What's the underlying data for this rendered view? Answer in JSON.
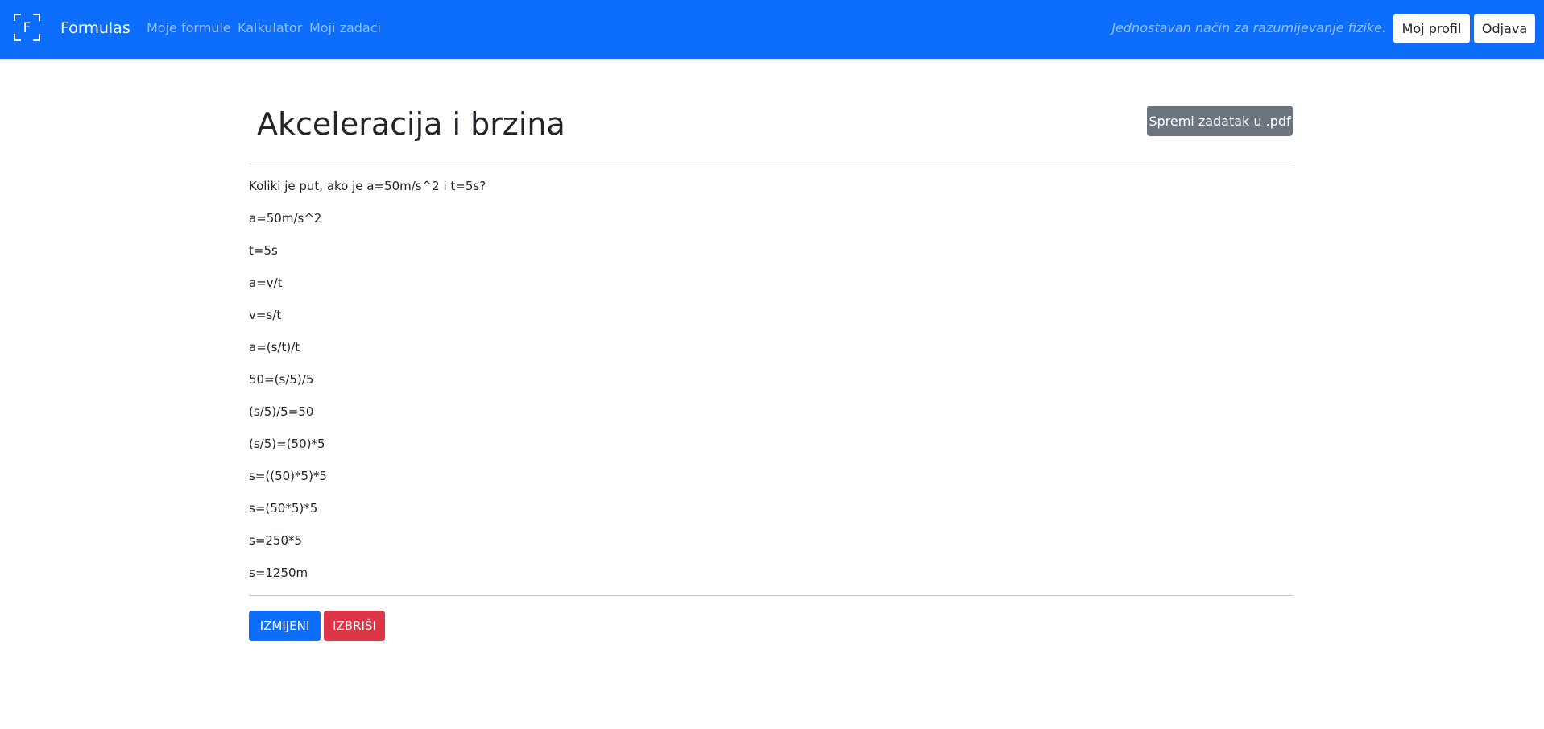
{
  "navbar": {
    "brand_letter": "F",
    "brand_name": "Formulas",
    "links": [
      "Moje formule",
      "Kalkulator",
      "Moji zadaci"
    ],
    "tagline": "Jednostavan način za razumijevanje fizike.",
    "profile_label": "Moj profil",
    "logout_label": "Odjava",
    "colors": {
      "background": "#0d6efd"
    }
  },
  "task": {
    "title": "Akceleracija i brzina",
    "pdf_button_label": "Spremi zadatak u .pdf",
    "steps": [
      "Koliki je put, ako je a=50m/s^2 i t=5s?",
      "a=50m/s^2",
      "t=5s",
      "a=v/t",
      "v=s/t",
      "a=(s/t)/t",
      "50=(s/5)/5",
      "(s/5)/5=50",
      "(s/5)=(50)*5",
      "s=((50)*5)*5",
      "s=(50*5)*5",
      "s=250*5",
      "s=1250m"
    ]
  },
  "actions": {
    "edit_label": "IZMIJENI",
    "delete_label": "IZBRIŠI",
    "colors": {
      "edit": "#0d6efd",
      "delete": "#dc3545",
      "pdf": "#6c757d"
    }
  }
}
